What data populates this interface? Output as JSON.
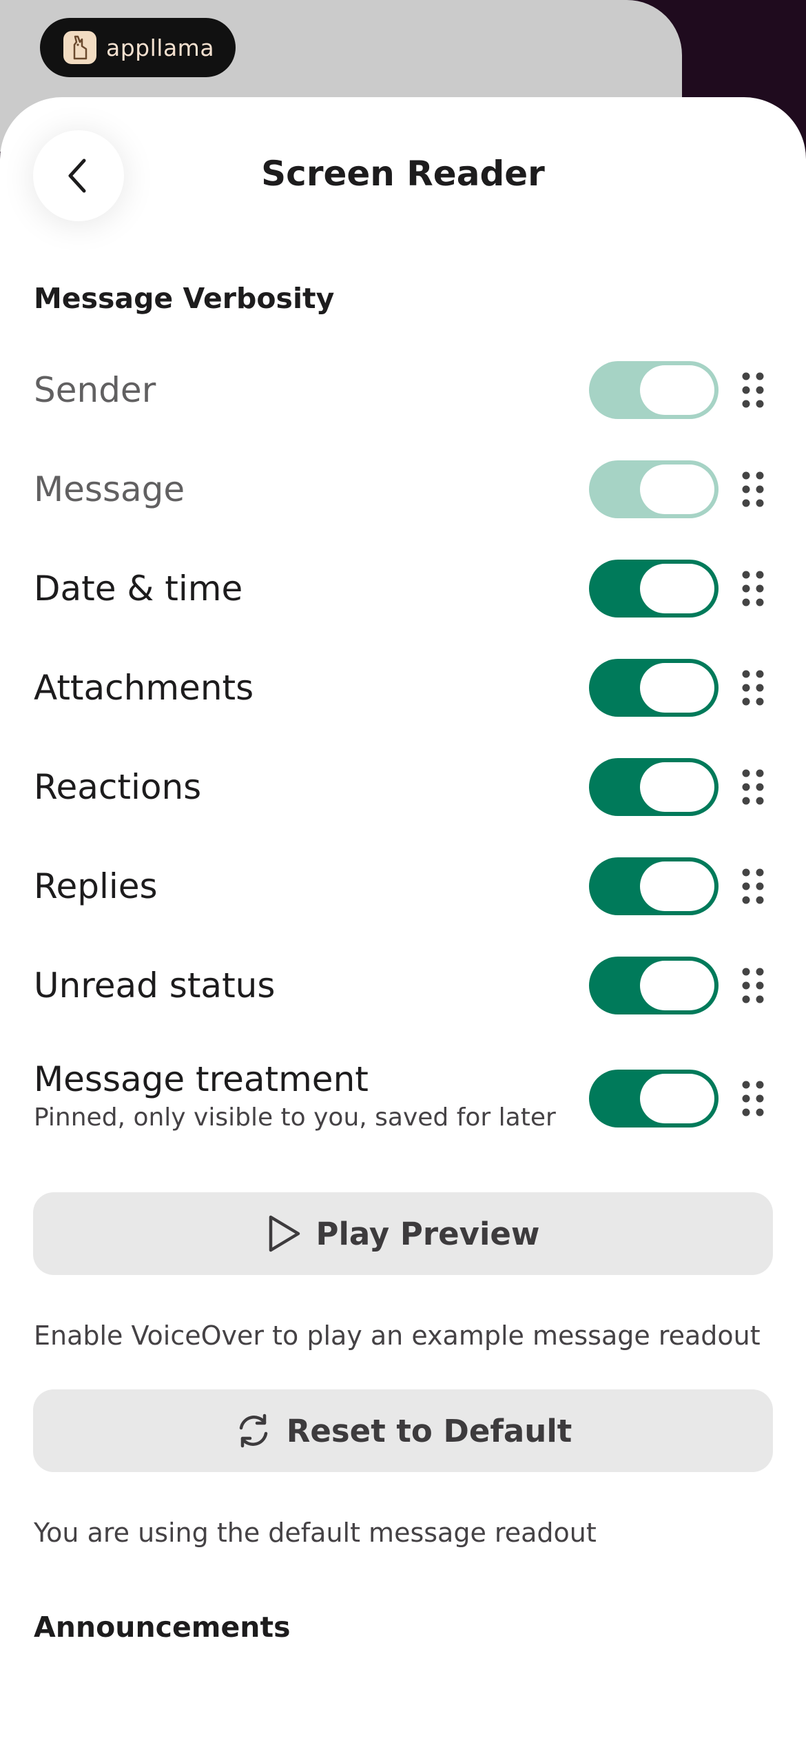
{
  "brand": {
    "name": "appllama",
    "icon": "llama-logo-icon"
  },
  "header": {
    "title": "Screen Reader",
    "back_icon": "chevron-left-icon"
  },
  "verbosity": {
    "heading": "Message Verbosity",
    "items": [
      {
        "label": "Sender",
        "on": true,
        "disabled": true
      },
      {
        "label": "Message",
        "on": true,
        "disabled": true
      },
      {
        "label": "Date & time",
        "on": true,
        "disabled": false
      },
      {
        "label": "Attachments",
        "on": true,
        "disabled": false
      },
      {
        "label": "Reactions",
        "on": true,
        "disabled": false
      },
      {
        "label": "Replies",
        "on": true,
        "disabled": false
      },
      {
        "label": "Unread status",
        "on": true,
        "disabled": false
      },
      {
        "label": "Message treatment",
        "sublabel": "Pinned, only visible to you, saved for later",
        "on": true,
        "disabled": false
      }
    ]
  },
  "preview": {
    "label": "Play Preview",
    "icon": "play-icon",
    "note": "Enable VoiceOver to play an example message readout"
  },
  "reset": {
    "label": "Reset to Default",
    "icon": "refresh-icon",
    "note": "You are using the default message readout"
  },
  "announcements": {
    "heading": "Announcements"
  },
  "colors": {
    "accent": "#007a5a",
    "accent_dim": "#a6d3c5",
    "button_bg": "#e8e8e8"
  }
}
